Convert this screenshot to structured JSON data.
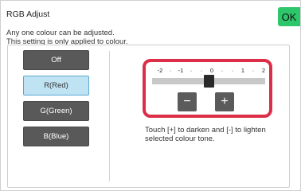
{
  "dialog": {
    "title": "RGB Adjust",
    "ok_label": "OK",
    "description_line1": "Any one colour can be adjusted.",
    "description_line2": "This setting is only applied to colour."
  },
  "color_options": [
    {
      "label": "Off",
      "selected": false
    },
    {
      "label": "R(Red)",
      "selected": true
    },
    {
      "label": "G(Green)",
      "selected": false
    },
    {
      "label": "B(Blue)",
      "selected": false
    }
  ],
  "adjuster": {
    "scale_labels": [
      "-2",
      "·",
      "-1",
      "·",
      "·",
      "0",
      "·",
      "·",
      "1",
      "·",
      "2"
    ],
    "min": -2,
    "max": 2,
    "value": 0,
    "minus_label": "−",
    "plus_label": "+"
  },
  "hint": {
    "line1": "Touch [+] to darken and [-] to lighten",
    "line2": "selected colour tone."
  },
  "colors": {
    "ok": "#2ec66a",
    "highlight": "#dd2e48",
    "selected_bg": "#bfe3f3",
    "button_bg": "#595959"
  }
}
